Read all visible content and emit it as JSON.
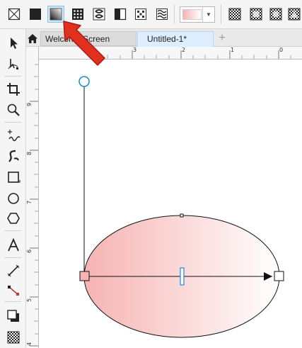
{
  "colors": {
    "fill_start": "#f6b3b3",
    "fill_end": "#ffffff",
    "selection_blue": "#1b8ad6",
    "annotation_arrow": "#e0301e"
  },
  "toolbar": {
    "fill_buttons": [
      {
        "icon": "no-fill-icon"
      },
      {
        "icon": "uniform-fill-icon"
      },
      {
        "icon": "fountain-fill-icon",
        "selected": true
      },
      {
        "icon": "vector-pattern-fill-icon"
      },
      {
        "icon": "bitmap-pattern-fill-icon"
      },
      {
        "icon": "two-color-pattern-fill-icon"
      },
      {
        "icon": "texture-fill-icon"
      },
      {
        "icon": "postscript-fill-icon"
      }
    ],
    "fill_color": {
      "start": "#f6b3b3",
      "end": "#ffffff"
    },
    "transparency_buttons": [
      {
        "icon": "checker-transparency-icon"
      },
      {
        "icon": "checker-linear-icon"
      },
      {
        "icon": "checker-elliptical-icon"
      },
      {
        "icon": "checker-conical-icon"
      }
    ]
  },
  "tabs": {
    "home_icon": "home-icon",
    "welcome": "Welcome Screen",
    "document": "Untitled-1*",
    "add": "+"
  },
  "rulers": {
    "horizontal_labels": [
      "3",
      "2",
      "1",
      "0"
    ],
    "vertical_labels": [
      "9",
      "8",
      "7",
      "6",
      "5",
      "4"
    ]
  },
  "tools": [
    "pick-tool-icon",
    "shape-tool-icon",
    "crop-tool-icon",
    "zoom-tool-icon",
    "freehand-tool-icon",
    "artistic-media-icon",
    "rectangle-tool-icon",
    "ellipse-tool-icon",
    "polygon-tool-icon",
    "text-tool-icon",
    "parallel-dimension-icon",
    "connector-tool-icon",
    "drop-shadow-icon",
    "transparency-tool-icon"
  ]
}
